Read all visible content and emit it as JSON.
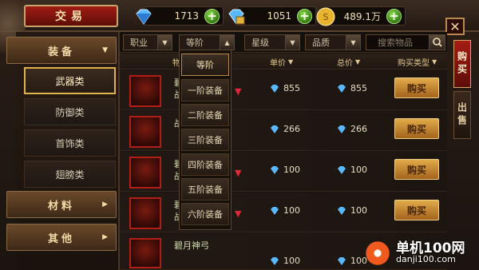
{
  "header": {
    "title": "交易",
    "currencies": [
      {
        "icon": "blue-diamond-icon",
        "value": "1713"
      },
      {
        "icon": "locked-diamond-icon",
        "value": "1051"
      },
      {
        "icon": "gold-coin-icon",
        "value": "489.1万"
      }
    ],
    "plus_label": "+",
    "close_label": "✕"
  },
  "sidebar": {
    "categories": [
      {
        "label": "装备",
        "arrow": "▼"
      },
      {
        "label": "材料",
        "arrow": "▶"
      },
      {
        "label": "其他",
        "arrow": "▶"
      }
    ],
    "sub_items": [
      "武器类",
      "防御类",
      "首饰类",
      "翅膀类"
    ],
    "active_sub": "武器类"
  },
  "filters": {
    "profession": "职业",
    "tier": "等阶",
    "star": "星级",
    "quality": "品质",
    "search_placeholder": "搜索物品"
  },
  "columns": {
    "item": "物",
    "unit_price": "单价",
    "total_price": "总价",
    "buy_type": "购买类型"
  },
  "rows": [
    {
      "name_line1": "碧",
      "name_line2": "战",
      "has_arrow": true,
      "unit": "855",
      "total": "855",
      "buy": "购买"
    },
    {
      "name_line1": "",
      "name_line2": "战",
      "has_arrow": false,
      "unit": "266",
      "total": "266",
      "buy": "购买"
    },
    {
      "name_line1": "碧",
      "name_line2": "战",
      "has_arrow": true,
      "unit": "100",
      "total": "100",
      "buy": "购买"
    },
    {
      "name_line1": "碧",
      "name_line2": "战",
      "has_arrow": true,
      "unit": "100",
      "total": "100",
      "buy": "购买"
    },
    {
      "name_line1": "碧月神弓",
      "name_line2": "",
      "has_arrow": false,
      "unit": "100",
      "total": "100",
      "buy": ""
    }
  ],
  "tier_dropdown": {
    "header": "等阶",
    "options": [
      "一阶装备",
      "二阶装备",
      "三阶装备",
      "四阶装备",
      "五阶装备",
      "六阶装备"
    ]
  },
  "side_tabs": [
    {
      "label": "购买",
      "active": true
    },
    {
      "label": "出售",
      "active": false
    }
  ],
  "watermark": {
    "brand": "单机100网",
    "url": "danji100.com"
  },
  "colors": {
    "accent_red": "#a01c14",
    "gold_border": "#c8a36a",
    "buy_button": "#e1aa4a"
  }
}
